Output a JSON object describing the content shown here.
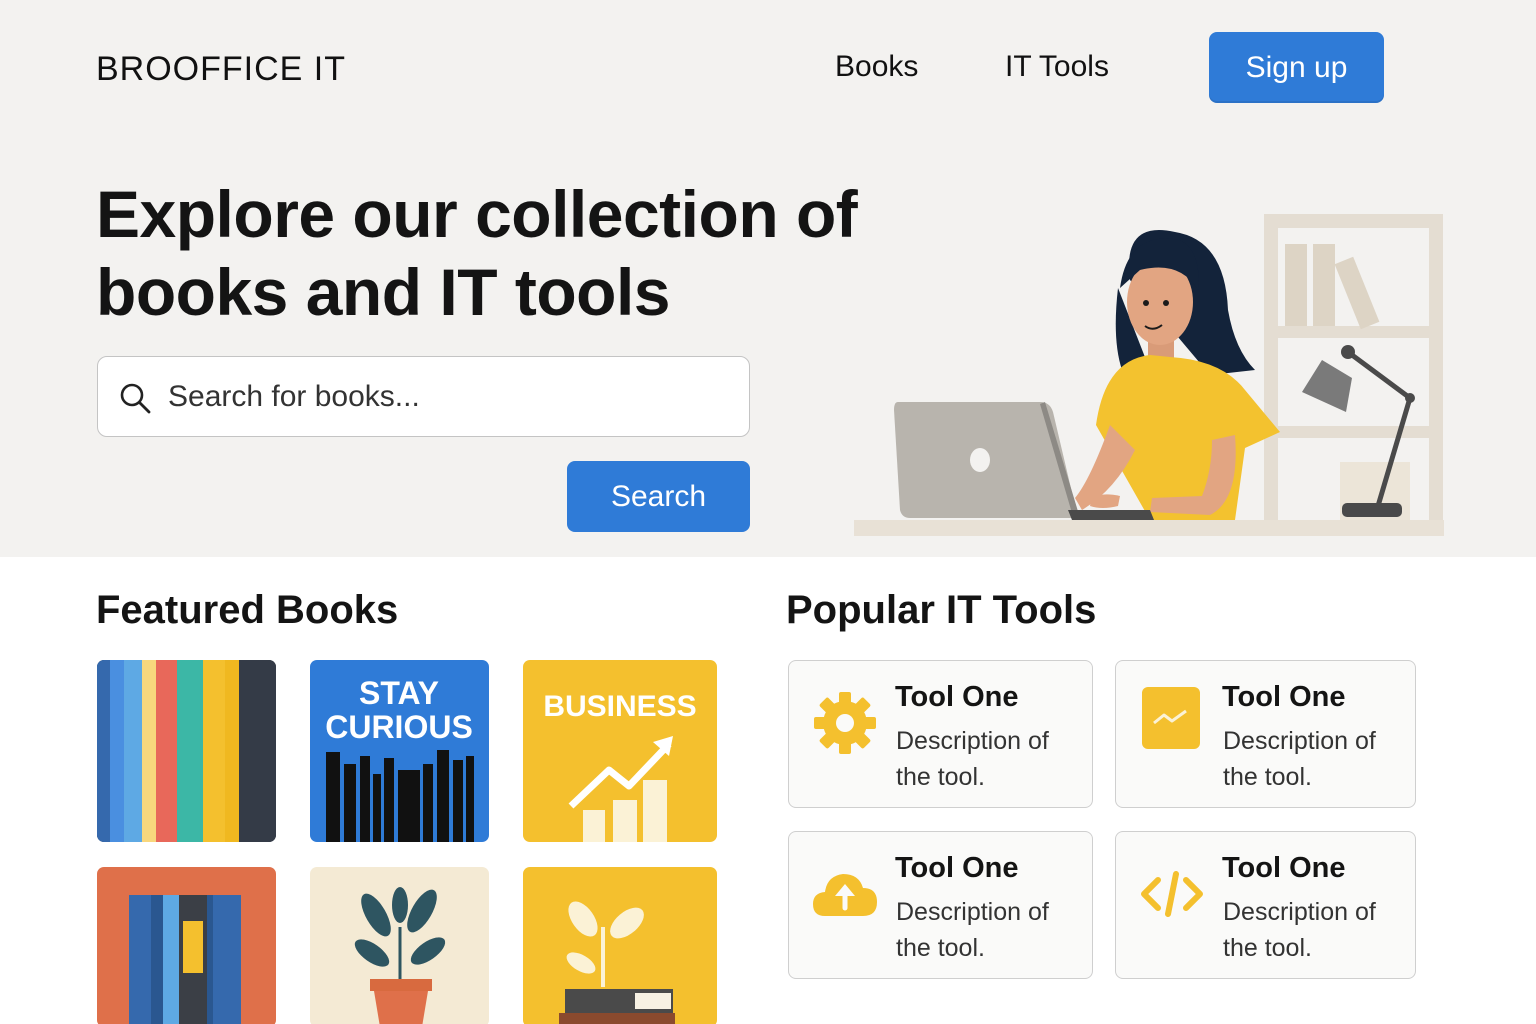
{
  "header": {
    "brand": "BROOFFICE IT",
    "nav": [
      {
        "label": "Books"
      },
      {
        "label": "IT Tools"
      }
    ],
    "signup_label": "Sign up"
  },
  "hero": {
    "headline": "Explore our collection of books and IT tools",
    "search": {
      "placeholder": "Search for books...",
      "value": ""
    },
    "search_button": "Search"
  },
  "featured_books": {
    "title": "Featured Books",
    "books": [
      {
        "cover_text": "",
        "style": "stripes"
      },
      {
        "cover_text_line1": "STAY",
        "cover_text_line2": "CURIOUS",
        "style": "blue-shelf"
      },
      {
        "cover_text": "BUSINESS",
        "style": "yellow-growth"
      },
      {
        "cover_text": "",
        "style": "orange-shelf"
      },
      {
        "cover_text": "",
        "style": "plant-pot"
      },
      {
        "cover_text": "",
        "style": "plant-books"
      }
    ]
  },
  "popular_tools": {
    "title": "Popular IT Tools",
    "tools": [
      {
        "name": "Tool One",
        "description": "Description of the tool.",
        "icon": "gear-icon"
      },
      {
        "name": "Tool One",
        "description": "Description of the tool.",
        "icon": "chart-icon"
      },
      {
        "name": "Tool One",
        "description": "Description of the tool.",
        "icon": "cloud-upload-icon"
      },
      {
        "name": "Tool One",
        "description": "Description of the tool.",
        "icon": "code-icon"
      }
    ]
  },
  "colors": {
    "accent_blue": "#2f7bd7",
    "accent_yellow": "#f4c02e",
    "hero_background": "#f3f2f0"
  }
}
